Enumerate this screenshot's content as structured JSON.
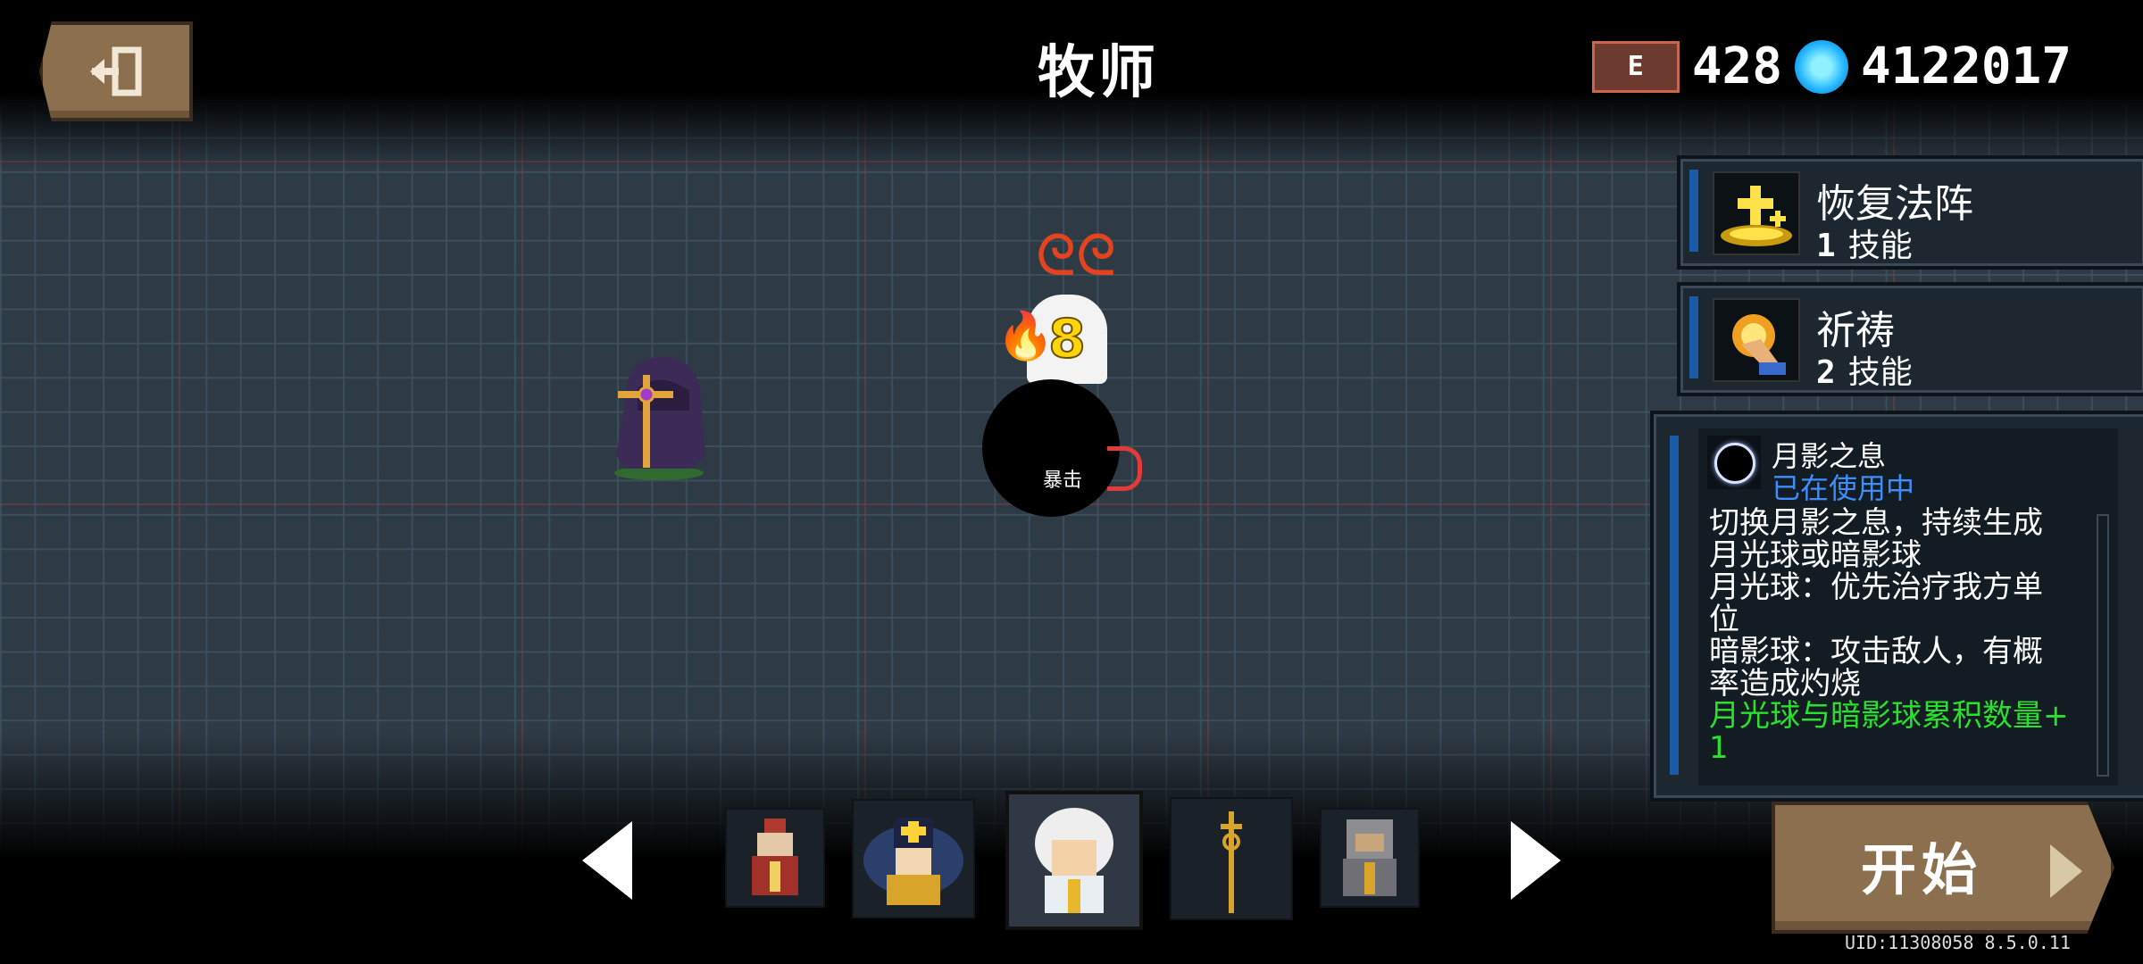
{
  "header": {
    "title": "牧师",
    "exit_icon": "exit-door-icon",
    "gem_badge": "E",
    "gems": "428",
    "coins": "4122017",
    "colors": {
      "gem_badge": "#c8674c",
      "coin": "#22b5ff"
    }
  },
  "battle": {
    "counter": "8",
    "crit_label": "暴击"
  },
  "skills": [
    {
      "name": "恢复法阵",
      "index": "1",
      "suffix": "技能",
      "icon": "golden-cross-circle-icon"
    },
    {
      "name": "祈祷",
      "index": "2",
      "suffix": "技能",
      "icon": "praying-hand-icon"
    }
  ],
  "detail": {
    "name": "月影之息",
    "status": "已在使用中",
    "lines": [
      "切换月影之息，持续生成",
      "月光球或暗影球",
      "月光球：优先治疗我方单",
      "位",
      "暗影球：攻击敌人，有概",
      "率造成灼烧"
    ],
    "bonus": "月光球与暗影球累积数量+",
    "bonus_value": "1"
  },
  "selector": {
    "slots": [
      "red-priest-skin",
      "golden-winged-priest-skin",
      "white-hair-priest-skin",
      "golden-staff-item",
      "gray-armor-skin"
    ],
    "selected_index": 2
  },
  "start": {
    "label": "开始"
  },
  "footer": {
    "uid": "UID:11308058 8.5.0.11"
  }
}
